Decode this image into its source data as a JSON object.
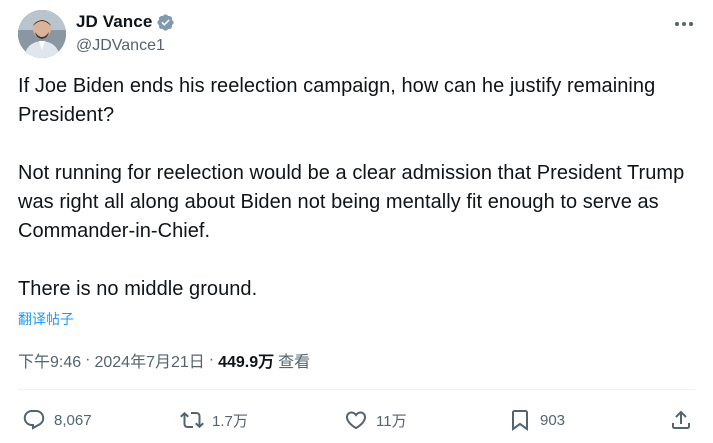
{
  "author": {
    "display_name": "JD Vance",
    "handle": "@JDVance1",
    "verified": true,
    "avatar_icon": "user-avatar-photo",
    "verified_badge_color": "#829aab"
  },
  "tweet": {
    "paragraphs": [
      "If Joe Biden ends his reelection campaign, how can he justify remaining President?",
      "Not running for reelection would be a clear admission that President Trump was right all along about Biden not being mentally fit enough to serve as Commander-in-Chief.",
      "There is no middle ground."
    ],
    "translate_label": "翻译帖子"
  },
  "meta": {
    "time": "下午9:46",
    "separator": "·",
    "date": "2024年7月21日",
    "views_count": "449.9万",
    "views_label": "查看"
  },
  "actions": {
    "replies": "8,067",
    "reposts": "1.7万",
    "likes": "11万",
    "bookmarks": "903"
  },
  "colors": {
    "text_primary": "#0f1419",
    "text_secondary": "#536471",
    "link": "#1d9bf0",
    "divider": "#eff3f4"
  }
}
